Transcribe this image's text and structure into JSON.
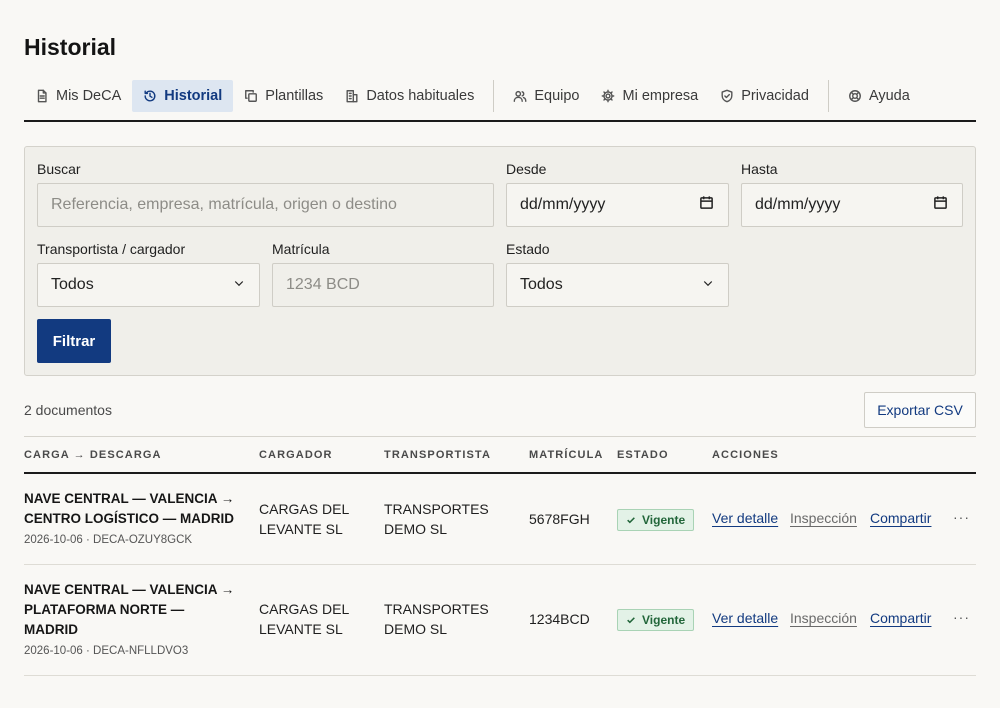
{
  "page": {
    "title": "Historial"
  },
  "tabs": [
    {
      "label": "Mis DeCA",
      "icon": "document-icon",
      "active": false
    },
    {
      "label": "Historial",
      "icon": "history-icon",
      "active": true
    },
    {
      "label": "Plantillas",
      "icon": "copy-icon",
      "active": false
    },
    {
      "label": "Datos habituales",
      "icon": "building-icon",
      "active": false
    },
    {
      "label": "Equipo",
      "icon": "users-icon",
      "active": false
    },
    {
      "label": "Mi empresa",
      "icon": "gear-icon",
      "active": false
    },
    {
      "label": "Privacidad",
      "icon": "shield-icon",
      "active": false
    },
    {
      "label": "Ayuda",
      "icon": "lifebuoy-icon",
      "active": false
    }
  ],
  "filters": {
    "search_label": "Buscar",
    "search_placeholder": "Referencia, empresa, matrícula, origen o destino",
    "from_label": "Desde",
    "from_value": "dd/mm/yyyy",
    "to_label": "Hasta",
    "to_value": "dd/mm/yyyy",
    "party_label": "Transportista / cargador",
    "party_value": "Todos",
    "plate_label": "Matrícula",
    "plate_placeholder": "1234 BCD",
    "status_label": "Estado",
    "status_value": "Todos",
    "submit_label": "Filtrar"
  },
  "results": {
    "count_text": "2 documentos",
    "export_label": "Exportar CSV"
  },
  "table": {
    "headers": {
      "route": "CARGA → DESCARGA",
      "shipper": "CARGADOR",
      "carrier": "TRANSPORTISTA",
      "plate": "MATRÍCULA",
      "status": "ESTADO",
      "actions": "ACCIONES"
    },
    "rows": [
      {
        "route_line1": "NAVE CENTRAL — VALENCIA →",
        "route_line2": "CENTRO LOGÍSTICO — MADRID",
        "route_line3": "",
        "meta": "2026-10-06 · DECA-OZUY8GCK",
        "shipper_line1": "CARGAS DEL",
        "shipper_line2": "LEVANTE SL",
        "carrier_line1": "TRANSPORTES",
        "carrier_line2": "DEMO SL",
        "plate": "5678FGH",
        "status": "Vigente",
        "action_detail": "Ver detalle",
        "action_inspection": "Inspección",
        "action_share": "Compartir",
        "more": "···"
      },
      {
        "route_line1": "NAVE CENTRAL — VALENCIA →",
        "route_line2": "PLATAFORMA NORTE —",
        "route_line3": "MADRID",
        "meta": "2026-10-06 · DECA-NFLLDVO3",
        "shipper_line1": "CARGAS DEL",
        "shipper_line2": "LEVANTE SL",
        "carrier_line1": "TRANSPORTES",
        "carrier_line2": "DEMO SL",
        "plate": "1234BCD",
        "status": "Vigente",
        "action_detail": "Ver detalle",
        "action_inspection": "Inspección",
        "action_share": "Compartir",
        "more": "···"
      }
    ]
  },
  "colors": {
    "accent": "#123a80",
    "success_bg": "#e3f2e7",
    "success_text": "#22663a",
    "tab_active_bg": "#dde6f1"
  }
}
